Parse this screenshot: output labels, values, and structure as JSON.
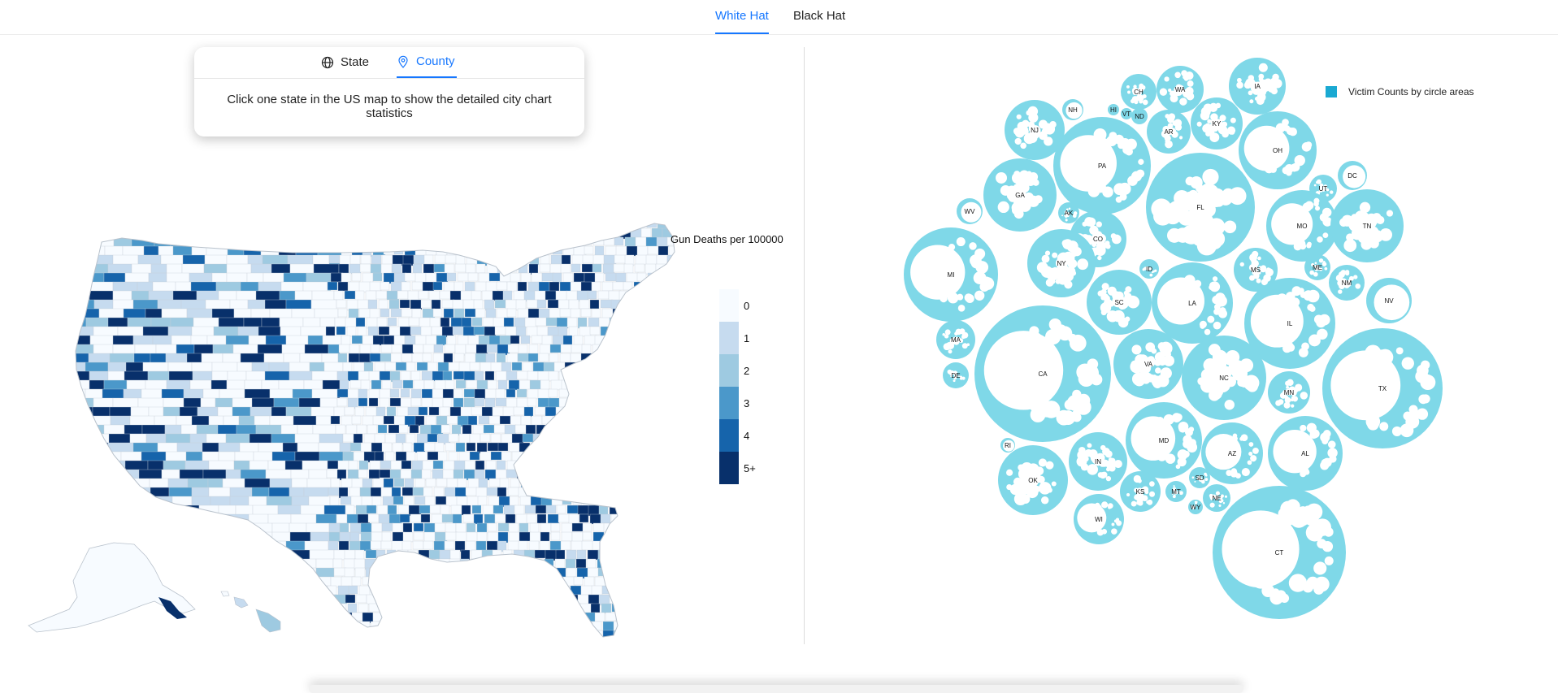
{
  "top_tabs": [
    {
      "label": "White Hat",
      "active": true
    },
    {
      "label": "Black Hat",
      "active": false
    }
  ],
  "panel": {
    "tabs": [
      {
        "label": "State",
        "icon": "globe-icon",
        "active": false
      },
      {
        "label": "County",
        "icon": "location-pin-icon",
        "active": true
      }
    ],
    "message": "Click one state in the US map to show the detailed city chart statistics"
  },
  "map": {
    "legend_title": "Gun Deaths per 100000",
    "legend": [
      {
        "label": "0",
        "color": "#f7fbff"
      },
      {
        "label": "1",
        "color": "#c6dbef"
      },
      {
        "label": "2",
        "color": "#9ecae1"
      },
      {
        "label": "3",
        "color": "#4b98ca"
      },
      {
        "label": "4",
        "color": "#1664ab"
      },
      {
        "label": "5+",
        "color": "#08306b"
      }
    ]
  },
  "bubble_chart": {
    "legend_label": "Victim Counts by circle areas",
    "legend_color": "#1aa9d2",
    "bubble_color": "#7fd8e8",
    "states": [
      "IA",
      "CH",
      "WA",
      "NH",
      "HI",
      "VT",
      "ND",
      "NJ",
      "AR",
      "KY",
      "PA",
      "OH",
      "GA",
      "FL",
      "UT",
      "DC",
      "WV",
      "AK",
      "MO",
      "TN",
      "CO",
      "MI",
      "NY",
      "ID",
      "MS",
      "ME",
      "NM",
      "SC",
      "LA",
      "IL",
      "NV",
      "MA",
      "CA",
      "VA",
      "NC",
      "MN",
      "TX",
      "DE",
      "MD",
      "RI",
      "AZ",
      "AL",
      "IN",
      "OK",
      "SD",
      "KS",
      "MT",
      "WY",
      "NE",
      "WI",
      "CT"
    ]
  }
}
